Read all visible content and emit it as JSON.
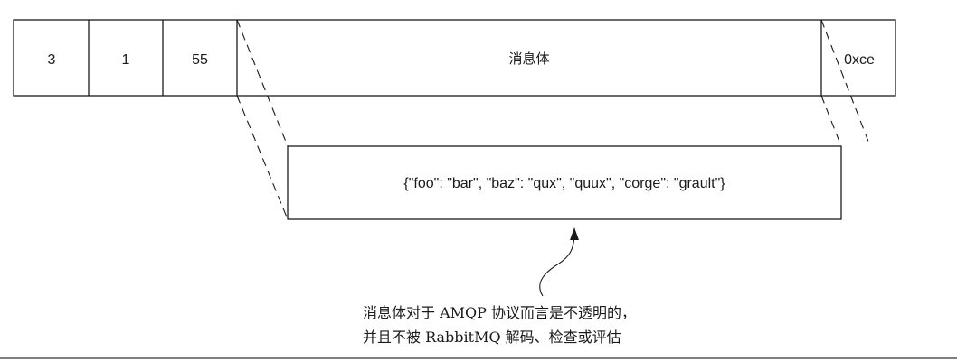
{
  "frame": {
    "cells": [
      "3",
      "1",
      "55",
      "消息体",
      "0xce"
    ]
  },
  "payload": {
    "text": "{\"foo\": \"bar\", \"baz\": \"qux\", \"quux\", \"corge\": \"grault\"}"
  },
  "annotation": {
    "line1": "消息体对于 AMQP 协议而言是不透明的，",
    "line2": "并且不被 RabbitMQ 解码、检查或评估"
  }
}
